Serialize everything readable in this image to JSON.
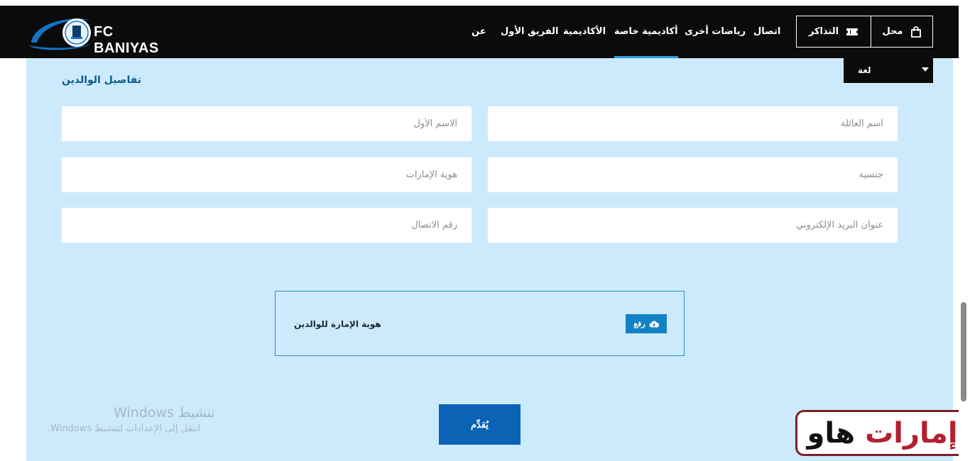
{
  "header": {
    "logo_text": "FC BANIYAS",
    "nav": [
      {
        "label": "عن"
      },
      {
        "label": "الفريق الأول"
      },
      {
        "label": "الأكاديمية"
      },
      {
        "label": "أكاديمية خاصة"
      },
      {
        "label": "رياضات أخرى"
      },
      {
        "label": "اتصال"
      }
    ],
    "tickets_label": "التذاكر",
    "shop_label": "محل"
  },
  "language": {
    "label": "لغة"
  },
  "form": {
    "section_title": "تفاصيل الوالدين",
    "fields": {
      "family_name": "اسم العائلة",
      "first_name": "الاسم الأول",
      "nationality": "جنسية",
      "emirates_id": "هوية الإمارات",
      "email": "عنوان البريد الإلكتروني",
      "phone": "رقم الاتصال"
    },
    "upload": {
      "label": "هوية الإمارة للوالدين",
      "button": "رفع"
    },
    "submit": "يُقدِّم"
  },
  "windows_notice": {
    "title": "تنشيط Windows",
    "subtitle": "انتقل إلى الإعدادات لتنشيط Windows."
  },
  "watermark": {
    "part1": "إمارات",
    "part2": "هاو"
  },
  "colors": {
    "header_bg": "#0b0b0b",
    "content_bg": "#cdeafd",
    "accent": "#0a63b5",
    "nav_active": "#2a9fd8"
  }
}
